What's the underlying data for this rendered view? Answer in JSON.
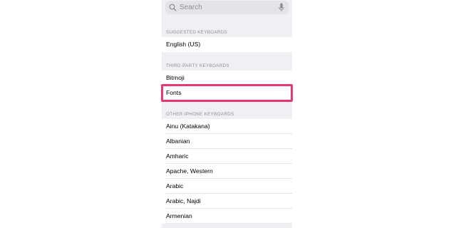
{
  "search": {
    "placeholder": "Search",
    "icon": "search-icon",
    "mic_icon": "microphone-icon"
  },
  "sections": {
    "suggested": {
      "header": "SUGGESTED KEYBOARDS",
      "items": [
        "English (US)"
      ]
    },
    "third_party": {
      "header": "THIRD-PARTY KEYBOARDS",
      "items": [
        "Bitmoji",
        "Fonts"
      ]
    },
    "other": {
      "header": "OTHER IPHONE KEYBOARDS",
      "items": [
        "Ainu (Katakana)",
        "Albanian",
        "Amharic",
        "Apache, Western",
        "Arabic",
        "Arabic, Najdi",
        "Armenian"
      ]
    }
  },
  "colors": {
    "highlight": "#e8396f",
    "background": "#efeff4",
    "secondary_text": "#8e8e93"
  }
}
